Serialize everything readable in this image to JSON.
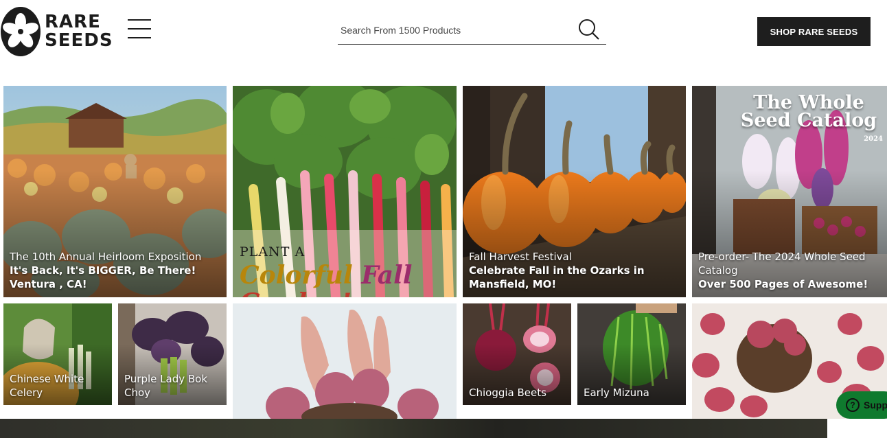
{
  "header": {
    "logo": {
      "line1": "RARE",
      "line2": "SEEDS"
    },
    "search_placeholder": "Search From 1500 Products",
    "shop_button": "SHOP RARE SEEDS"
  },
  "tiles": [
    {
      "title": "The 10th Annual Heirloom Exposition",
      "subtitle": "It's Back, It's BIGGER, Be There! Ventura , CA!"
    },
    {
      "overlay_top": "PLANT A",
      "overlay_script": [
        "Colorful",
        "Fall",
        "Garden!"
      ]
    },
    {
      "title": "Fall Harvest Festival",
      "subtitle": "Celebrate Fall in the Ozarks in Mansfield, MO!"
    },
    {
      "catalog_title": "The Whole Seed Catalog",
      "catalog_year": "2024",
      "title": "Pre-order- The 2024 Whole Seed Catalog",
      "subtitle": "Over 500 Pages of Awesome!"
    }
  ],
  "products": [
    {
      "label": "Chinese White Celery"
    },
    {
      "label": "Purple Lady Bok Choy"
    },
    {
      "label": "Chioggia Beets"
    },
    {
      "label": "Early Mizuna"
    }
  ],
  "support": {
    "label": "Supp"
  },
  "colors": {
    "brand_dark": "#1e1e1e",
    "support_green": "#0f7a2e"
  }
}
